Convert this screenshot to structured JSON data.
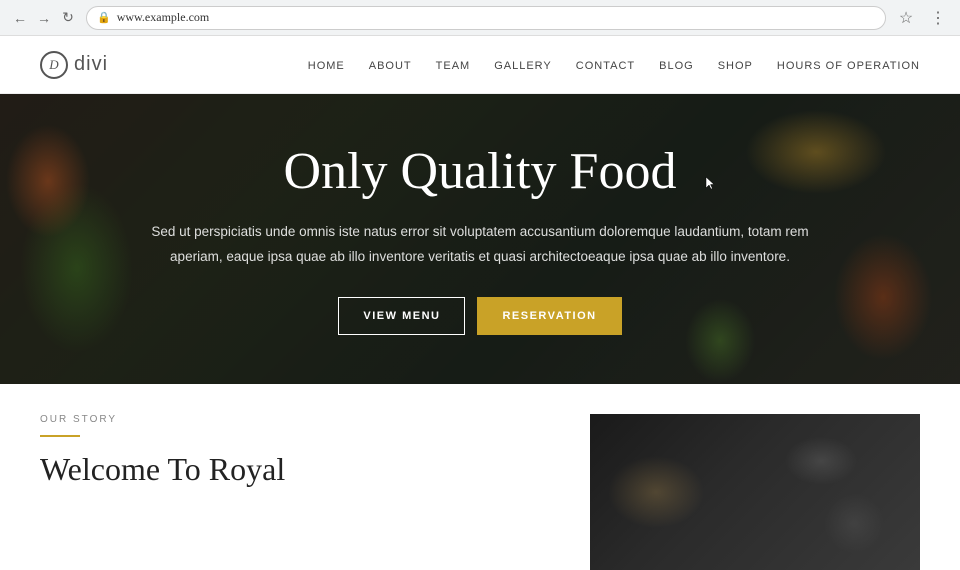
{
  "browser": {
    "url": "www.example.com",
    "back_disabled": false,
    "forward_disabled": true
  },
  "nav": {
    "logo_letter": "D",
    "logo_name": "divi",
    "links": [
      {
        "label": "HOME",
        "id": "home"
      },
      {
        "label": "ABOUT",
        "id": "about"
      },
      {
        "label": "TEAM",
        "id": "team"
      },
      {
        "label": "GALLERY",
        "id": "gallery"
      },
      {
        "label": "CONTACT",
        "id": "contact"
      },
      {
        "label": "BLOG",
        "id": "blog"
      },
      {
        "label": "SHOP",
        "id": "shop"
      },
      {
        "label": "HOURS OF OPERATION",
        "id": "hours"
      }
    ]
  },
  "hero": {
    "title": "Only Quality Food",
    "subtitle": "Sed ut perspiciatis unde omnis iste natus error sit voluptatem accusantium doloremque laudantium, totam rem aperiam, eaque ipsa quae ab illo inventore veritatis et quasi architectoeaque ipsa quae ab illo inventore.",
    "btn_menu": "VIEW MENU",
    "btn_reservation": "RESERVATION"
  },
  "story": {
    "section_label": "OUR STORY",
    "title": "Welcome To Royal"
  }
}
